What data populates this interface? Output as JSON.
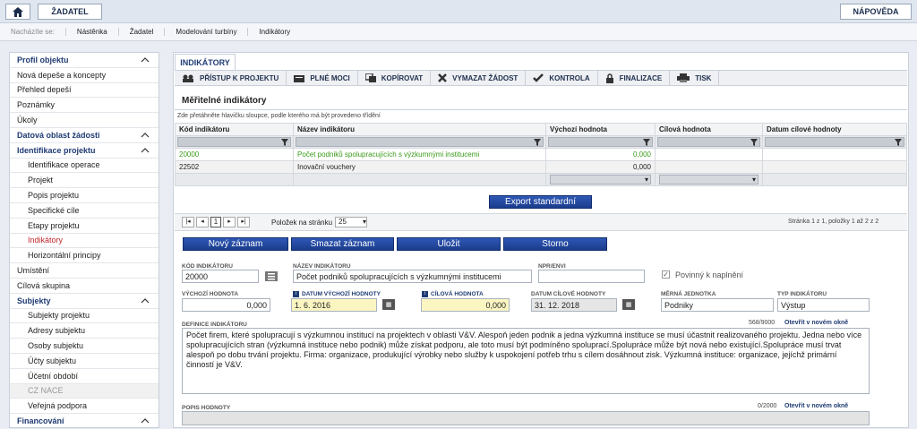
{
  "topbar": {
    "applicant": "ŽADATEL",
    "help": "NÁPOVĚDA"
  },
  "breadcrumb": {
    "label": "Nacházíte se:",
    "items": [
      "Nástěnka",
      "Žadatel",
      "Modelování turbíny",
      "Indikátory"
    ]
  },
  "sidebar": [
    {
      "label": "Profil objektu",
      "type": "hdr",
      "chev": true
    },
    {
      "label": "Nová depeše a koncepty",
      "type": "item"
    },
    {
      "label": "Přehled depeší",
      "type": "item"
    },
    {
      "label": "Poznámky",
      "type": "item"
    },
    {
      "label": "Úkoly",
      "type": "item"
    },
    {
      "label": "Datová oblast žádosti",
      "type": "hdr",
      "chev": true
    },
    {
      "label": "Identifikace projektu",
      "type": "hdr",
      "chev": true
    },
    {
      "label": "Identifikace operace",
      "type": "sub"
    },
    {
      "label": "Projekt",
      "type": "sub"
    },
    {
      "label": "Popis projektu",
      "type": "sub"
    },
    {
      "label": "Specifické cíle",
      "type": "sub"
    },
    {
      "label": "Etapy projektu",
      "type": "sub"
    },
    {
      "label": "Indikátory",
      "type": "sub active"
    },
    {
      "label": "Horizontální principy",
      "type": "sub"
    },
    {
      "label": "Umístění",
      "type": "item"
    },
    {
      "label": "Cílová skupina",
      "type": "item"
    },
    {
      "label": "Subjekty",
      "type": "hdr",
      "chev": true
    },
    {
      "label": "Subjekty projektu",
      "type": "sub"
    },
    {
      "label": "Adresy subjektu",
      "type": "sub"
    },
    {
      "label": "Osoby subjektu",
      "type": "sub"
    },
    {
      "label": "Účty subjektu",
      "type": "sub"
    },
    {
      "label": "Účetní období",
      "type": "sub"
    },
    {
      "label": "CZ NACE",
      "type": "sub dis"
    },
    {
      "label": "Veřejná podpora",
      "type": "sub"
    },
    {
      "label": "Financování",
      "type": "hdr",
      "chev": true
    }
  ],
  "tab": "INDIKÁTORY",
  "toolbar": [
    "PŘÍSTUP K PROJEKTU",
    "PLNÉ MOCI",
    "KOPÍROVAT",
    "VYMAZAT ŽÁDOST",
    "KONTROLA",
    "FINALIZACE",
    "TISK"
  ],
  "section_title": "Měřitelné indikátory",
  "hint": "Zde přetáhněte hlavičku sloupce, podle kterého má být provedeno třídění",
  "table": {
    "headers": [
      "Kód indikátoru",
      "Název indikátoru",
      "Výchozí hodnota",
      "Cílová hodnota",
      "Datum cílové hodnoty"
    ],
    "rows": [
      {
        "code": "20000",
        "name": "Počet podniků spolupracujících s výzkumnými institucemi",
        "start": "0,000",
        "target": "",
        "date": ""
      },
      {
        "code": "22502",
        "name": "Inovační vouchery",
        "start": "0,000",
        "target": "",
        "date": ""
      }
    ]
  },
  "export": "Export standardní",
  "pager": {
    "page": "1",
    "per_page_label": "Položek na stránku",
    "per_page": "25",
    "info": "Stránka 1 z 1, položky 1 až 2 z 2"
  },
  "actions": [
    "Nový záznam",
    "Smazat záznam",
    "Uložit",
    "Storno"
  ],
  "form": {
    "code_label": "KÓD INDIKÁTORU",
    "code": "20000",
    "name_label": "NÁZEV INDIKÁTORU",
    "name": "Počet podniků spolupracujících s výzkumnými institucemi",
    "npr_label": "NPR/ENVI",
    "npr": "",
    "mandatory": "Povinný k naplnění",
    "start_label": "VÝCHOZÍ HODNOTA",
    "start": "0,000",
    "start_date_label": "DATUM VÝCHOZÍ HODNOTY",
    "start_date": "1. 6. 2016",
    "target_label": "CÍLOVÁ HODNOTA",
    "target": "0,000",
    "target_date_label": "DATUM CÍLOVÉ HODNOTY",
    "target_date": "31. 12. 2018",
    "unit_label": "MĚRNÁ JEDNOTKA",
    "unit": "Podniky",
    "type_label": "TYP INDIKÁTORU",
    "type": "Výstup",
    "def_label": "DEFINICE INDIKÁTORU",
    "def_count": "568/9000",
    "open_new": "Otevřít v novém okně",
    "definition": "Počet firem, které spolupracují s výzkumnou institucí na projektech v oblasti V&V. Alespoň jeden podnik a jedna výzkumná instituce se musí účastnit realizovaného projektu. Jedna nebo více spolupracujících stran (výzkumná instituce nebo podnik) může získat podporu, ale toto musí být podmíněno spoluprací.Spolupráce může být nová nebo existující.Spolupráce musí trvat alespoň po dobu trvání projektu. Firma: organizace, produkující výrobky nebo služby k uspokojení potřeb trhu s cílem dosáhnout zisk. Výzkumná instituce: organizace, jejíchž primární činností je V&V.",
    "desc_label": "POPIS HODNOTY",
    "desc_count": "0/2000"
  }
}
